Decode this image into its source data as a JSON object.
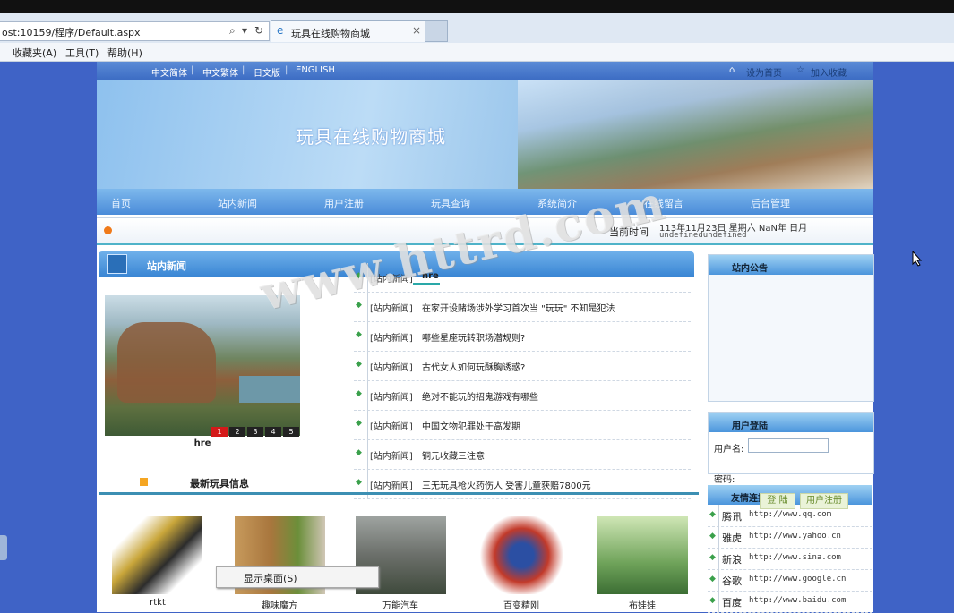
{
  "browser": {
    "address": "ost:10159/程序/Default.aspx",
    "tab_title": "玩具在线购物商城",
    "menus": [
      "收藏夹(A)",
      "工具(T)",
      "帮助(H)"
    ]
  },
  "header": {
    "languages": [
      "中文简体",
      "中文繁体",
      "日文版",
      "ENGLISH"
    ],
    "set_home": "设为首页",
    "add_fav": "加入收藏",
    "site_title": "玩具在线购物商城"
  },
  "nav": [
    "首页",
    "站内新闻",
    "用户注册",
    "玩具查询",
    "系统简介",
    "在线留言",
    "后台管理"
  ],
  "timebar": {
    "label": "当前时间",
    "value": "113年11月23日 星期六 NaN年 日月",
    "value2": "undefinedundefined"
  },
  "news": {
    "heading": "站内新闻",
    "slide_caption": "hre",
    "pager": [
      "1",
      "2",
      "3",
      "4",
      "5"
    ],
    "items": [
      {
        "tag": "[站内新闻]",
        "title": "hre"
      },
      {
        "tag": "[站内新闻]",
        "title": "在家开设赌场涉外学习首次当 \"玩玩\" 不知是犯法"
      },
      {
        "tag": "[站内新闻]",
        "title": "哪些星座玩转职场潜规则?"
      },
      {
        "tag": "[站内新闻]",
        "title": "古代女人如何玩酥胸诱惑?"
      },
      {
        "tag": "[站内新闻]",
        "title": "绝对不能玩的招鬼游戏有哪些"
      },
      {
        "tag": "[站内新闻]",
        "title": "中国文物犯罪处于高发期"
      },
      {
        "tag": "[站内新闻]",
        "title": "铜元收藏三注意"
      },
      {
        "tag": "[站内新闻]",
        "title": "三无玩具枪火药伤人 受害儿童获赔7800元"
      }
    ]
  },
  "toys": {
    "heading": "最新玩具信息",
    "items": [
      {
        "name": "rtkt",
        "color": "#c9a63a"
      },
      {
        "name": "趣味魔方",
        "color": "#b98a4f"
      },
      {
        "name": "万能汽车",
        "color": "#6b6f6a"
      },
      {
        "name": "百变精刚",
        "color": "#2b4fa3"
      },
      {
        "name": "布娃娃",
        "color": "#6fa35a"
      }
    ]
  },
  "sidebar": {
    "notice_heading": "站内公告",
    "login_heading": "用户登陆",
    "username_label": "用户名:",
    "password_label": "密码:",
    "login_button": "登 陆",
    "register_button": "用户注册",
    "links_heading": "友情连接",
    "links": [
      {
        "name": "腾讯",
        "url": "http://www.qq.com"
      },
      {
        "name": "雅虎",
        "url": "http://www.yahoo.cn"
      },
      {
        "name": "新浪",
        "url": "http://www.sina.com"
      },
      {
        "name": "谷歌",
        "url": "http://www.google.cn"
      },
      {
        "name": "百度",
        "url": "http://www.baidu.com"
      }
    ]
  },
  "overlay": {
    "context_menu": "显示桌面(S)",
    "watermark": "www.httrd.com"
  },
  "colors": {
    "page_bg": "#3f63c6",
    "nav_bar": "#4a8bd9",
    "accent_line": "#4fb3c9"
  }
}
